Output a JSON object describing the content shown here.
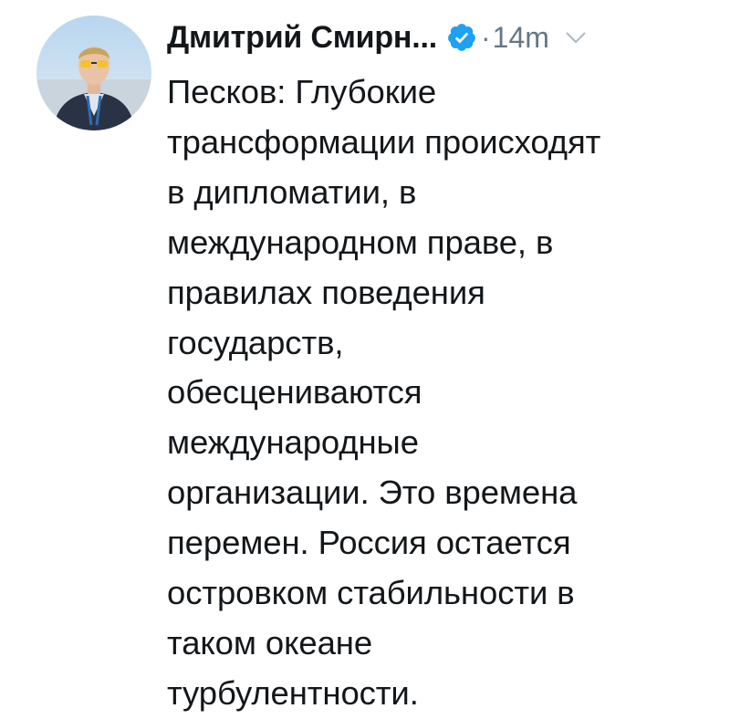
{
  "tweet": {
    "author_name": "Дмитрий Смирн...",
    "verified": true,
    "separator": "·",
    "timestamp": "14m",
    "text_lines": [
      "Песков: Глубокие",
      "трансформации происходят",
      "в дипломатии, в",
      "международном праве, в",
      "правилах поведения",
      "государств,",
      "обесцениваются",
      "международные",
      "организации. Это времена",
      "перемен. Россия остается",
      "островком стабильности в",
      "таком океане",
      "турбулентности."
    ]
  },
  "icons": {
    "verified": "verified-badge-icon",
    "menu": "chevron-down-icon"
  },
  "colors": {
    "text": "#14171a",
    "muted": "#657786",
    "verified_blue": "#1da1f2",
    "background": "#ffffff"
  }
}
